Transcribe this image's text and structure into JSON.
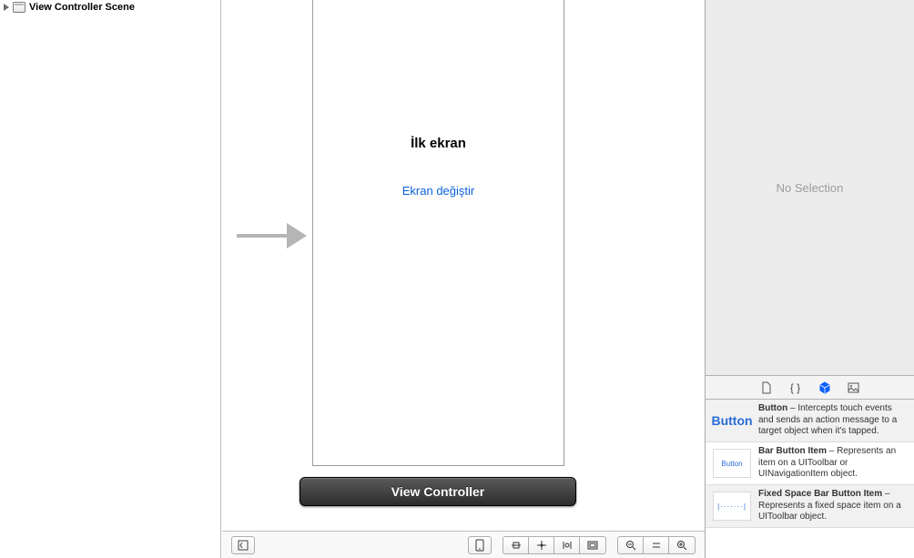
{
  "outline": {
    "scene_label": "View Controller Scene"
  },
  "canvas": {
    "label_text": "İlk ekran",
    "button_text": "Ekran değiştir",
    "title_bar": "View Controller"
  },
  "inspector": {
    "empty_text": "No Selection"
  },
  "library": {
    "items": [
      {
        "thumb_text": "Button",
        "title": "Button",
        "desc": " – Intercepts touch events and sends an action message to a target object when it's tapped."
      },
      {
        "thumb_text": "Button",
        "title": "Bar Button Item",
        "desc": " – Represents an item on a UIToolbar or UINavigationItem object."
      },
      {
        "thumb_text": "|·······|",
        "title": "Fixed Space Bar Button Item",
        "desc": " – Represents a fixed space item on a UIToolbar object."
      }
    ]
  }
}
